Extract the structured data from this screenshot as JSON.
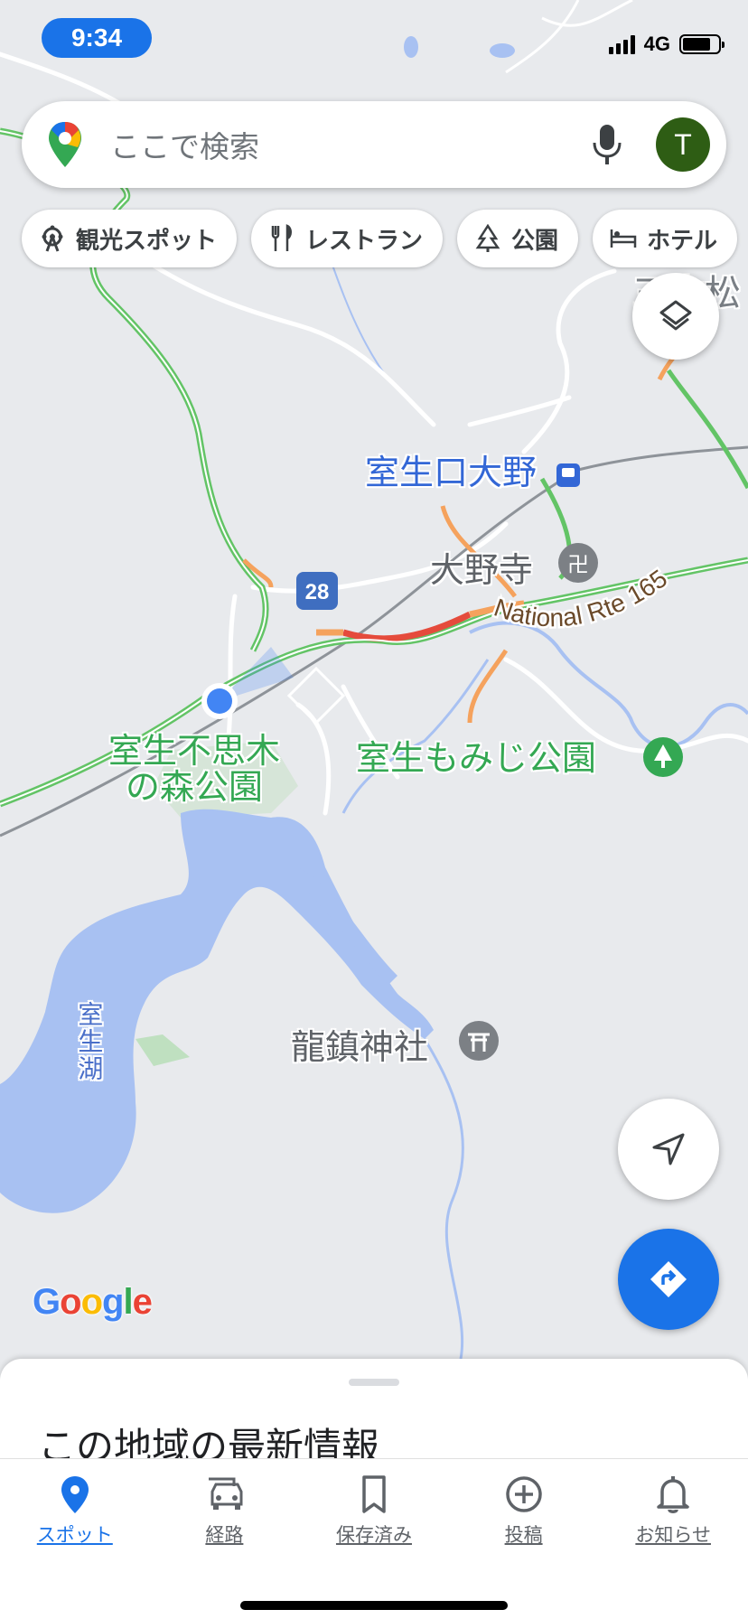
{
  "status_bar": {
    "time": "9:34",
    "network": "4G"
  },
  "search": {
    "placeholder": "ここで検索",
    "avatar_letter": "T"
  },
  "chips": [
    {
      "label": "観光スポット",
      "icon": "ferris-wheel-icon"
    },
    {
      "label": "レストラン",
      "icon": "fork-knife-icon"
    },
    {
      "label": "公園",
      "icon": "tree-icon"
    },
    {
      "label": "ホテル",
      "icon": "bed-icon"
    }
  ],
  "map": {
    "labels": {
      "station": "室生口大野",
      "temple": "大野寺",
      "forest_line1": "室生不思木",
      "forest_line2": "の森公園",
      "momiji_park": "室生もみじ公園",
      "shrine": "龍鎮神社",
      "lake": "室生湖",
      "sanboku": "三本松",
      "route_shield": "28",
      "national_route": "National Rte 165"
    },
    "attribution": "Google"
  },
  "sheet": {
    "title": "この地域の最新情報"
  },
  "nav": [
    {
      "label": "スポット",
      "icon": "location-pin-icon",
      "active": true
    },
    {
      "label": "経路",
      "icon": "car-icon",
      "active": false
    },
    {
      "label": "保存済み",
      "icon": "bookmark-icon",
      "active": false
    },
    {
      "label": "投稿",
      "icon": "plus-circle-icon",
      "active": false
    },
    {
      "label": "お知らせ",
      "icon": "bell-icon",
      "active": false
    }
  ],
  "colors": {
    "accent": "#1a73e8",
    "map_bg": "#e8eaed",
    "water": "#a8c1f2",
    "traffic_green": "#63c466",
    "traffic_orange": "#f5a25d",
    "traffic_red": "#e54b3c"
  }
}
